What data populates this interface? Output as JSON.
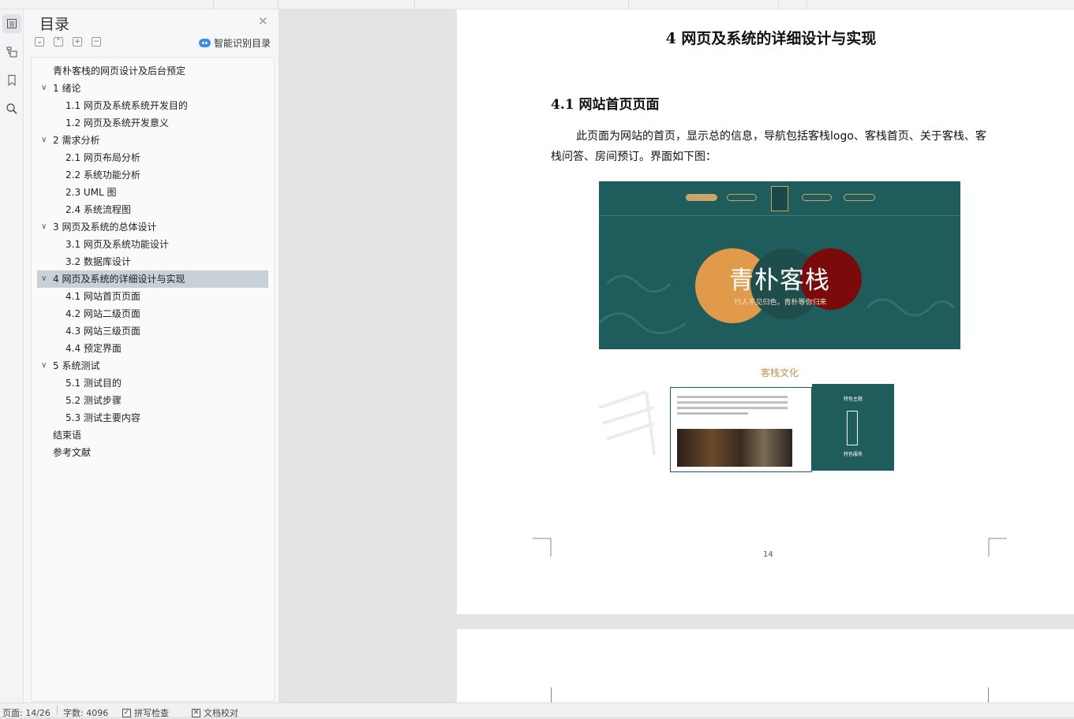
{
  "toc": {
    "title": "目录",
    "smart_label": "智能识别目录",
    "items": [
      {
        "label": "青朴客栈的网页设计及后台预定",
        "level": 0,
        "expandable": false,
        "active": false
      },
      {
        "label": "1  绪论",
        "level": 1,
        "expandable": true,
        "active": false
      },
      {
        "label": "1.1 网页及系统系统开发目的",
        "level": 2,
        "expandable": false,
        "active": false
      },
      {
        "label": "1.2 网页及系统开发意义",
        "level": 2,
        "expandable": false,
        "active": false
      },
      {
        "label": "2  需求分析",
        "level": 1,
        "expandable": true,
        "active": false
      },
      {
        "label": "2.1  网页布局分析",
        "level": 2,
        "expandable": false,
        "active": false
      },
      {
        "label": "2.2  系统功能分析",
        "level": 2,
        "expandable": false,
        "active": false
      },
      {
        "label": "2.3 UML 图",
        "level": 2,
        "expandable": false,
        "active": false
      },
      {
        "label": "2.4  系统流程图",
        "level": 2,
        "expandable": false,
        "active": false
      },
      {
        "label": "3  网页及系统的总体设计",
        "level": 1,
        "expandable": true,
        "active": false
      },
      {
        "label": "3.1  网页及系统功能设计",
        "level": 2,
        "expandable": false,
        "active": false
      },
      {
        "label": "3.2  数据库设计",
        "level": 2,
        "expandable": false,
        "active": false
      },
      {
        "label": "4  网页及系统的详细设计与实现",
        "level": 1,
        "expandable": true,
        "active": true
      },
      {
        "label": "4.1  网站首页页面",
        "level": 2,
        "expandable": false,
        "active": false
      },
      {
        "label": "4.2  网站二级页面",
        "level": 2,
        "expandable": false,
        "active": false
      },
      {
        "label": "4.3  网站三级页面",
        "level": 2,
        "expandable": false,
        "active": false
      },
      {
        "label": "4.4  预定界面",
        "level": 2,
        "expandable": false,
        "active": false
      },
      {
        "label": "5  系统测试",
        "level": 1,
        "expandable": true,
        "active": false
      },
      {
        "label": "5.1  测试目的",
        "level": 2,
        "expandable": false,
        "active": false
      },
      {
        "label": "5.2  测试步骤",
        "level": 2,
        "expandable": false,
        "active": false
      },
      {
        "label": "5.3  测试主要内容",
        "level": 2,
        "expandable": false,
        "active": false
      },
      {
        "label": "结束语",
        "level": 0,
        "expandable": false,
        "active": false
      },
      {
        "label": "参考文献",
        "level": 0,
        "expandable": false,
        "active": false
      }
    ]
  },
  "document": {
    "chapter_heading": "4  网页及系统的详细设计与实现",
    "section_heading": "4.1  网站首页页面",
    "paragraph": "此页面为网站的首页，显示总的信息，导航包括客栈logo、客栈首页、关于客栈、客栈问答、房间预订。界面如下图：",
    "page_number": "14",
    "screenshot": {
      "banner_title": "青朴客栈",
      "banner_subtitle": "行人不见归色，青朴等你归来",
      "culture_title": "客栈文化",
      "card_heading_1": "特色主题",
      "card_heading_2": "特色服务"
    }
  },
  "status": {
    "page": "页面: 14/26",
    "words": "字数: 4096",
    "spellcheck": "拼写检查",
    "proofread": "文档校对"
  },
  "colors": {
    "teal": "#1f5d5d",
    "orange": "#e09a4a",
    "dark_red": "#7b0b0b",
    "active_row": "#c8d0d8",
    "accent_blue": "#3b8ee8"
  }
}
